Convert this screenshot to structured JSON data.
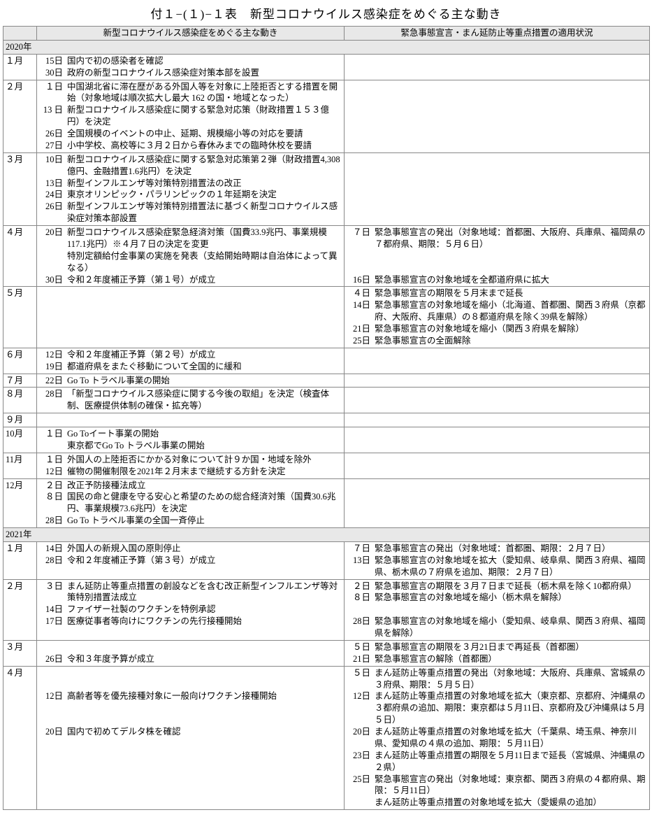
{
  "title": "付１−(１)−１表　新型コロナウイルス感染症をめぐる主な動き",
  "head": {
    "c1": "",
    "c2": "新型コロナウイルス感染症をめぐる主な動き",
    "c3": "緊急事態宣言・まん延防止等重点措置の適用状況"
  },
  "years": [
    {
      "label": "2020年",
      "rows": [
        {
          "month": "１月",
          "main": [
            {
              "d": "15日",
              "t": "国内で初の感染者を確認"
            },
            {
              "d": "30日",
              "t": "政府の新型コロナウイルス感染症対策本部を設置"
            }
          ],
          "decl": []
        },
        {
          "month": "２月",
          "main": [
            {
              "d": "１日",
              "t": "中国湖北省に滞在歴がある外国人等を対象に上陸拒否とする措置を開始（対象地域は順次拡大し最大 162 の国・地域となった）"
            },
            {
              "d": "13 日",
              "t": "新型コロナウイルス感染症に関する緊急対応策（財政措置１５３億円）を決定"
            },
            {
              "d": "26日",
              "t": "全国規模のイベントの中止、延期、規模縮小等の対応を要請"
            },
            {
              "d": "27日",
              "t": "小中学校、高校等に３月２日から春休みまでの臨時休校を要請"
            }
          ],
          "decl": []
        },
        {
          "month": "３月",
          "main": [
            {
              "d": "10日",
              "t": "新型コロナウイルス感染症に関する緊急対応策第２弾（財政措置4,308億円、金融措置1.6兆円）を決定"
            },
            {
              "d": "13日",
              "t": "新型インフルエンザ等対策特別措置法の改正"
            },
            {
              "d": "24日",
              "t": "東京オリンピック・パラリンピックの１年延期を決定"
            },
            {
              "d": "26日",
              "t": "新型インフルエンザ等対策特別措置法に基づく新型コロナウイルス感染症対策本部設置"
            }
          ],
          "decl": []
        },
        {
          "month": "４月",
          "main": [
            {
              "d": "20日",
              "t": "新型コロナウイルス感染症緊急経済対策（国費33.9兆円、事業規模117.1兆円）※４月７日の決定を変更"
            },
            {
              "d": "",
              "t": "特別定額給付金事業の実施を発表（支給開始時期は自治体によって異なる）"
            },
            {
              "d": "30日",
              "t": "令和２年度補正予算（第１号）が成立"
            }
          ],
          "decl": [
            {
              "d": "７日",
              "t": "緊急事態宣言の発出（対象地域：首都圏、大阪府、兵庫県、福岡県の７都府県、期限：５月６日）"
            },
            {
              "gap": "gap1"
            },
            {
              "d": "16日",
              "t": "緊急事態宣言の対象地域を全都道府県に拡大"
            }
          ]
        },
        {
          "month": "５月",
          "main": [],
          "decl": [
            {
              "d": "４日",
              "t": "緊急事態宣言の期限を５月末まで延長"
            },
            {
              "d": "14日",
              "t": "緊急事態宣言の対象地域を縮小（北海道、首都圏、関西３府県（京都府、大阪府、兵庫県）の８都道府県を除く39県を解除）"
            },
            {
              "d": "21日",
              "t": "緊急事態宣言の対象地域を縮小（関西３府県を解除）"
            },
            {
              "d": "25日",
              "t": "緊急事態宣言の全面解除"
            }
          ]
        },
        {
          "month": "６月",
          "main": [
            {
              "d": "12日",
              "t": "令和２年度補正予算（第２号）が成立"
            },
            {
              "d": "19日",
              "t": "都道府県をまたぐ移動について全国的に緩和"
            }
          ],
          "decl": []
        },
        {
          "month": "７月",
          "main": [
            {
              "d": "22日",
              "t": "Go To トラベル事業の開始"
            }
          ],
          "decl": []
        },
        {
          "month": "８月",
          "main": [
            {
              "d": "28日",
              "t": "「新型コロナウイルス感染症に関する今後の取組」を決定（検査体制、医療提供体制の確保・拡充等）"
            }
          ],
          "decl": []
        },
        {
          "month": "９月",
          "main": [],
          "decl": []
        },
        {
          "month": "10月",
          "main": [
            {
              "d": "１日",
              "t": "Go Toイート事業の開始"
            },
            {
              "d": "",
              "t": "東京都でGo To トラベル事業の開始"
            }
          ],
          "decl": []
        },
        {
          "month": "11月",
          "main": [
            {
              "d": "１日",
              "t": "外国人の上陸拒否にかかる対象について計９か国・地域を除外"
            },
            {
              "d": "12日",
              "t": "催物の開催制限を2021年２月末まで継続する方針を決定"
            }
          ],
          "decl": []
        },
        {
          "month": "12月",
          "main": [
            {
              "d": "２日",
              "t": "改正予防接種法成立"
            },
            {
              "d": "８日",
              "t": "国民の命と健康を守る安心と希望のための総合経済対策（国費30.6兆円、事業規模73.6兆円）を決定"
            },
            {
              "d": "28日",
              "t": "Go To トラベル事業の全国一斉停止"
            }
          ],
          "decl": []
        }
      ]
    },
    {
      "label": "2021年",
      "rows": [
        {
          "month": "１月",
          "main": [
            {
              "d": "14日",
              "t": "外国人の新規入国の原則停止"
            },
            {
              "d": "28日",
              "t": "令和２年度補正予算（第３号）が成立"
            }
          ],
          "decl": [
            {
              "d": "７日",
              "t": "緊急事態宣言の発出（対象地域：首都圏、期限：２月７日）"
            },
            {
              "d": "13日",
              "t": "緊急事態宣言の対象地域を拡大（愛知県、岐阜県、関西３府県、福岡県、栃木県の７府県を追加、期限：２月７日）"
            }
          ]
        },
        {
          "month": "２月",
          "main": [
            {
              "d": "３日",
              "t": "まん延防止等重点措置の創設などを含む改正新型インフルエンザ等対策特別措置法成立"
            },
            {
              "d": "14日",
              "t": "ファイザー社製のワクチンを特例承認"
            },
            {
              "d": "17日",
              "t": "医療従事者等向けにワクチンの先行接種開始"
            }
          ],
          "decl": [
            {
              "d": "２日",
              "t": "緊急事態宣言の期限を３月７日まで延長（栃木県を除く10都府県）"
            },
            {
              "d": "８日",
              "t": "緊急事態宣言の対象地域を縮小（栃木県を解除）"
            },
            {
              "gap": "spacer"
            },
            {
              "d": "28日",
              "t": "緊急事態宣言の対象地域を縮小（愛知県、岐阜県、関西３府県、福岡県を解除）"
            }
          ]
        },
        {
          "month": "３月",
          "main": [
            {
              "gap": "spacer"
            },
            {
              "d": "26日",
              "t": "令和３年度予算が成立"
            }
          ],
          "decl": [
            {
              "d": "５日",
              "t": "緊急事態宣言の期限を３月21日まで再延長（首都圏）"
            },
            {
              "d": "21日",
              "t": "緊急事態宣言の解除（首都圏）"
            }
          ]
        },
        {
          "month": "４月",
          "main": [
            {
              "gap": "gap1"
            },
            {
              "d": "12日",
              "t": "高齢者等を優先接種対象に一般向けワクチン接種開始"
            },
            {
              "gap": "gap1"
            },
            {
              "d": "20日",
              "t": "国内で初めてデルタ株を確認"
            }
          ],
          "decl": [
            {
              "d": "５日",
              "t": "まん延防止等重点措置の発出（対象地域：大阪府、兵庫県、宮城県の３府県、期限：５月５日）"
            },
            {
              "d": "12日",
              "t": "まん延防止等重点措置の対象地域を拡大（東京都、京都府、沖縄県の３都府県の追加、期限：東京都は５月11日、京都府及び沖縄県は５月５日）"
            },
            {
              "d": "20日",
              "t": "まん延防止等重点措置の対象地域を拡大（千葉県、埼玉県、神奈川県、愛知県の４県の追加、期限：５月11日）"
            },
            {
              "d": "23日",
              "t": "まん延防止等重点措置の期限を５月11日まで延長（宮城県、沖縄県の２県）"
            },
            {
              "d": "25日",
              "t": "緊急事態宣言の発出（対象地域：東京都、関西３府県の４都府県、期限：５月11日）"
            },
            {
              "d": "",
              "t": "まん延防止等重点措置の対象地域を拡大（愛媛県の追加）"
            }
          ]
        }
      ]
    }
  ]
}
